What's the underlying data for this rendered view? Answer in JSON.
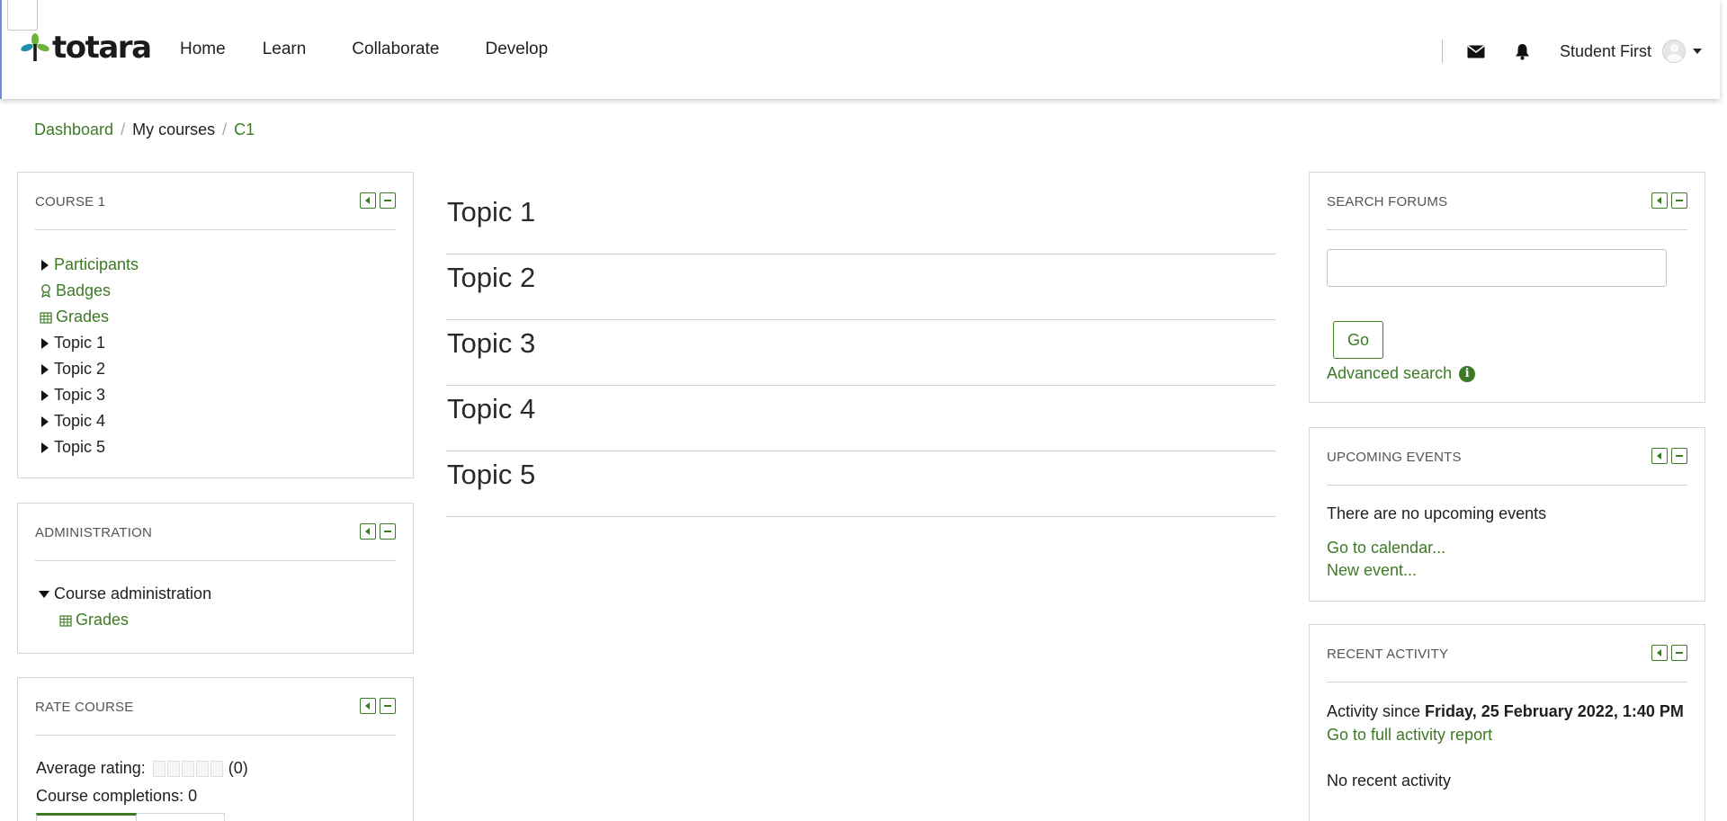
{
  "header": {
    "logo_text": "totara",
    "nav": [
      "Home",
      "Learn",
      "Collaborate",
      "Develop"
    ],
    "user_name": "Student First"
  },
  "breadcrumb": {
    "items": [
      "Dashboard",
      "My courses",
      "C1"
    ],
    "separator": "/"
  },
  "left": {
    "course_block": {
      "title": "COURSE 1",
      "items": [
        {
          "label": "Participants",
          "icon": "triangle-right",
          "link": true
        },
        {
          "label": "Badges",
          "icon": "badge-icon",
          "link": true
        },
        {
          "label": "Grades",
          "icon": "grades-table-icon",
          "link": true
        },
        {
          "label": "Topic 1",
          "icon": "triangle-right",
          "link": false
        },
        {
          "label": "Topic 2",
          "icon": "triangle-right",
          "link": false
        },
        {
          "label": "Topic 3",
          "icon": "triangle-right",
          "link": false
        },
        {
          "label": "Topic 4",
          "icon": "triangle-right",
          "link": false
        },
        {
          "label": "Topic 5",
          "icon": "triangle-right",
          "link": false
        }
      ]
    },
    "admin_block": {
      "title": "ADMINISTRATION",
      "course_admin": "Course administration",
      "grades": "Grades"
    },
    "rate_block": {
      "title": "RATE COURSE",
      "avg_label": "Average rating:",
      "avg_count": "(0)",
      "completions": "Course completions: 0"
    }
  },
  "main": {
    "topics": [
      "Topic 1",
      "Topic 2",
      "Topic 3",
      "Topic 4",
      "Topic 5"
    ]
  },
  "right": {
    "search_block": {
      "title": "SEARCH FORUMS",
      "input_value": "",
      "go_label": "Go",
      "advanced": "Advanced search",
      "info_glyph": "i"
    },
    "events_block": {
      "title": "UPCOMING EVENTS",
      "empty": "There are no upcoming events",
      "calendar_link": "Go to calendar...",
      "new_event_link": "New event..."
    },
    "activity_block": {
      "title": "RECENT ACTIVITY",
      "since_prefix": "Activity since",
      "since_date": "Friday, 25 February 2022, 1:40 PM",
      "report_link": "Go to full activity report",
      "empty": "No recent activity"
    }
  },
  "colors": {
    "accent": "#3d7a25",
    "logo_green": "#6bb33a",
    "logo_teal": "#1f8fa8"
  }
}
